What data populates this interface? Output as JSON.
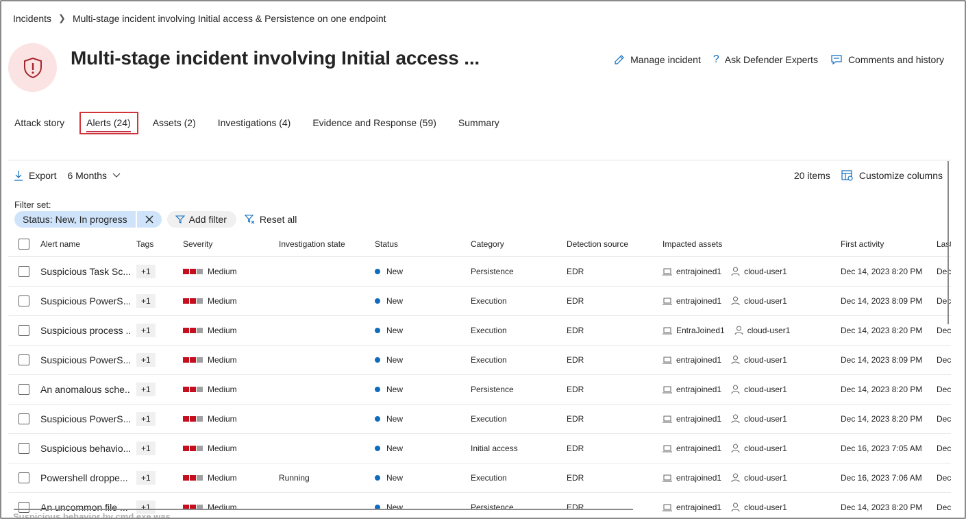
{
  "breadcrumb": {
    "root": "Incidents",
    "current": "Multi-stage incident involving Initial access & Persistence on one endpoint"
  },
  "header": {
    "title": "Multi-stage incident involving Initial access ...",
    "actions": {
      "manage": "Manage incident",
      "experts": "Ask Defender Experts",
      "comments": "Comments and history"
    }
  },
  "tabs": [
    {
      "label": "Attack story"
    },
    {
      "label": "Alerts (24)",
      "active": true
    },
    {
      "label": "Assets (2)"
    },
    {
      "label": "Investigations (4)"
    },
    {
      "label": "Evidence and Response (59)"
    },
    {
      "label": "Summary"
    }
  ],
  "toolbar": {
    "export": "Export",
    "range": "6 Months",
    "count": "20 items",
    "customize": "Customize columns"
  },
  "filters": {
    "label": "Filter set:",
    "chip_key": "Status:",
    "chip_value": "New, In progress",
    "add": "Add filter",
    "reset": "Reset all"
  },
  "table": {
    "headers": {
      "name": "Alert name",
      "tags": "Tags",
      "severity": "Severity",
      "investigation": "Investigation state",
      "status": "Status",
      "category": "Category",
      "detection": "Detection source",
      "assets": "Impacted assets",
      "first": "First activity",
      "last": "Last"
    },
    "rows": [
      {
        "name": "Suspicious Task Sc...",
        "tags": "+1",
        "severity": "Medium",
        "investigation": "",
        "status": "New",
        "category": "Persistence",
        "detection": "EDR",
        "device": "entrajoined1",
        "user": "cloud-user1",
        "first": "Dec 14, 2023 8:20 PM",
        "last": "Dec"
      },
      {
        "name": "Suspicious PowerS...",
        "tags": "+1",
        "severity": "Medium",
        "investigation": "",
        "status": "New",
        "category": "Execution",
        "detection": "EDR",
        "device": "entrajoined1",
        "user": "cloud-user1",
        "first": "Dec 14, 2023 8:09 PM",
        "last": "Dec"
      },
      {
        "name": "Suspicious process ...",
        "tags": "+1",
        "severity": "Medium",
        "investigation": "",
        "status": "New",
        "category": "Execution",
        "detection": "EDR",
        "device": "EntraJoined1",
        "user": "cloud-user1",
        "first": "Dec 14, 2023 8:20 PM",
        "last": "Dec"
      },
      {
        "name": "Suspicious PowerS...",
        "tags": "+1",
        "severity": "Medium",
        "investigation": "",
        "status": "New",
        "category": "Execution",
        "detection": "EDR",
        "device": "entrajoined1",
        "user": "cloud-user1",
        "first": "Dec 14, 2023 8:09 PM",
        "last": "Dec"
      },
      {
        "name": "An anomalous sche...",
        "tags": "+1",
        "severity": "Medium",
        "investigation": "",
        "status": "New",
        "category": "Persistence",
        "detection": "EDR",
        "device": "entrajoined1",
        "user": "cloud-user1",
        "first": "Dec 14, 2023 8:20 PM",
        "last": "Dec"
      },
      {
        "name": "Suspicious PowerS...",
        "tags": "+1",
        "severity": "Medium",
        "investigation": "",
        "status": "New",
        "category": "Execution",
        "detection": "EDR",
        "device": "entrajoined1",
        "user": "cloud-user1",
        "first": "Dec 14, 2023 8:20 PM",
        "last": "Dec"
      },
      {
        "name": "Suspicious behavio...",
        "tags": "+1",
        "severity": "Medium",
        "investigation": "",
        "status": "New",
        "category": "Initial access",
        "detection": "EDR",
        "device": "entrajoined1",
        "user": "cloud-user1",
        "first": "Dec 16, 2023 7:05 AM",
        "last": "Dec"
      },
      {
        "name": "Powershell droppe...",
        "tags": "+1",
        "severity": "Medium",
        "investigation": "Running",
        "status": "New",
        "category": "Execution",
        "detection": "EDR",
        "device": "entrajoined1",
        "user": "cloud-user1",
        "first": "Dec 16, 2023 7:06 AM",
        "last": "Dec"
      },
      {
        "name": "An uncommon file ...",
        "tags": "+1",
        "severity": "Medium",
        "investigation": "",
        "status": "New",
        "category": "Persistence",
        "detection": "EDR",
        "device": "entrajoined1",
        "user": "cloud-user1",
        "first": "Dec 14, 2023 8:20 PM",
        "last": "Dec"
      }
    ]
  },
  "footer_ghost": "Suspicious behavior by cmd.exe was",
  "colors": {
    "accent": "#0f6cbd",
    "severity_red": "#c50f1f",
    "severity_grey": "#a0a0a0",
    "status_new": "#0f6cbd",
    "hero_bg": "#fbe3e4",
    "hero_icon": "#a4262c",
    "filter_chip": "#cfe4fa"
  }
}
